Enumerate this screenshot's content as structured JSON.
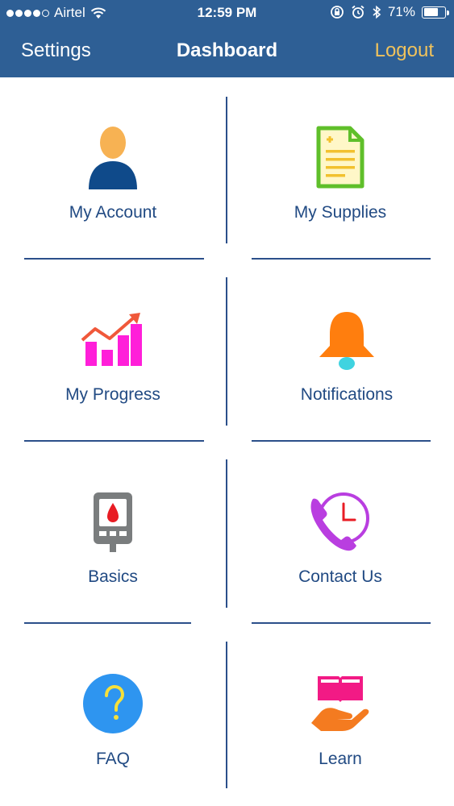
{
  "status_bar": {
    "carrier": "Airtel",
    "time": "12:59 PM",
    "battery": "71%",
    "battery_level": 71
  },
  "nav": {
    "left": "Settings",
    "title": "Dashboard",
    "right": "Logout"
  },
  "tiles": [
    {
      "label": "My Account",
      "icon": "person-icon"
    },
    {
      "label": "My Supplies",
      "icon": "document-icon"
    },
    {
      "label": "My Progress",
      "icon": "chart-icon"
    },
    {
      "label": "Notifications",
      "icon": "bell-icon"
    },
    {
      "label": "Basics",
      "icon": "glucose-meter-icon"
    },
    {
      "label": "Contact Us",
      "icon": "phone-clock-icon"
    },
    {
      "label": "FAQ",
      "icon": "question-icon"
    },
    {
      "label": "Learn",
      "icon": "book-hand-icon"
    }
  ],
  "colors": {
    "header": "#2e5f95",
    "logout": "#f0c25c",
    "label": "#214a83",
    "divider": "#2b4f8a"
  }
}
